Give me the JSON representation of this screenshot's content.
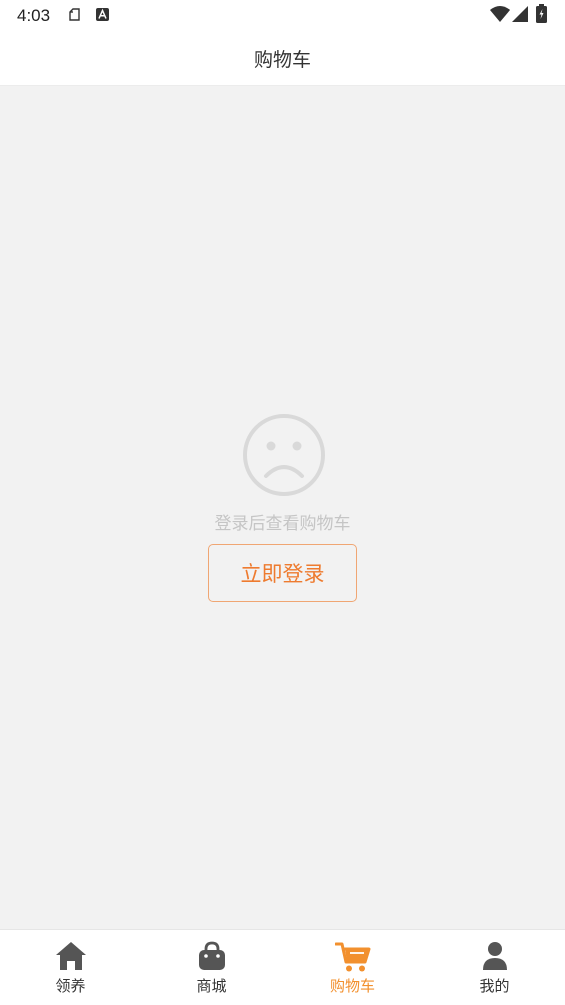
{
  "status_bar": {
    "time": "4:03"
  },
  "header": {
    "title": "购物车"
  },
  "empty_state": {
    "message": "登录后查看购物车",
    "login_button_label": "立即登录"
  },
  "bottom_nav": {
    "items": [
      {
        "label": "领养",
        "icon": "home-icon"
      },
      {
        "label": "商城",
        "icon": "shopping-bag-icon"
      },
      {
        "label": "购物车",
        "icon": "shopping-cart-icon",
        "active": true
      },
      {
        "label": "我的",
        "icon": "user-icon"
      }
    ]
  },
  "colors": {
    "accent": "#f2902e",
    "button_text": "#ee7b2f",
    "background": "#f2f2f2",
    "inactive_icon": "#555555"
  }
}
